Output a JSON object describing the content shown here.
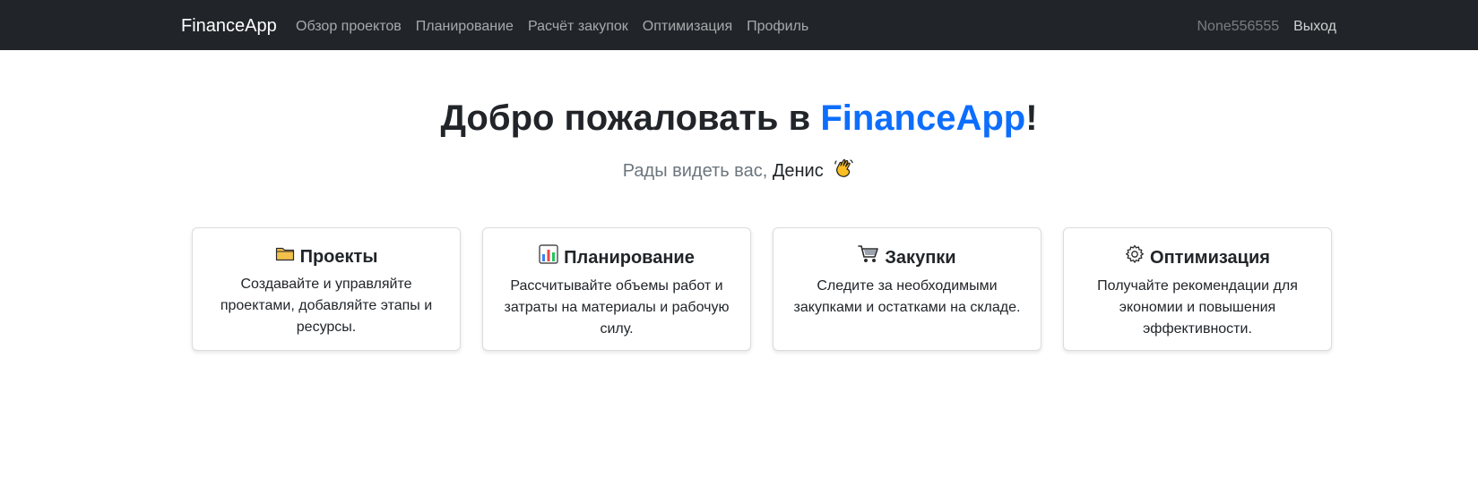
{
  "navbar": {
    "brand": "FinanceApp",
    "links": [
      {
        "label": "Обзор проектов"
      },
      {
        "label": "Планирование"
      },
      {
        "label": "Расчёт закупок"
      },
      {
        "label": "Оптимизация"
      },
      {
        "label": "Профиль"
      }
    ],
    "username": "None556555",
    "logout_label": "Выход"
  },
  "hero": {
    "title_prefix": "Добро пожаловать в ",
    "title_accent": "FinanceApp",
    "title_suffix": "!",
    "subtitle_prefix": "Рады видеть вас, ",
    "subtitle_name": "Денис",
    "wave_icon": "waving-hand-icon"
  },
  "cards": [
    {
      "icon": "folder-icon",
      "title": "Проекты",
      "text": "Создавайте и управляйте проектами, добавляйте этапы и ресурсы."
    },
    {
      "icon": "bar-chart-icon",
      "title": "Планирование",
      "text": "Рассчитывайте объемы работ и затраты на материалы и рабочую силу."
    },
    {
      "icon": "shopping-cart-icon",
      "title": "Закупки",
      "text": "Следите за необходимыми закупками и остатками на складе."
    },
    {
      "icon": "gear-icon",
      "title": "Оптимизация",
      "text": "Получайте рекомендации для экономии и повышения эффективности."
    }
  ],
  "colors": {
    "navbar_bg": "#212529",
    "accent": "#0d6efd",
    "muted": "#6c757d"
  }
}
